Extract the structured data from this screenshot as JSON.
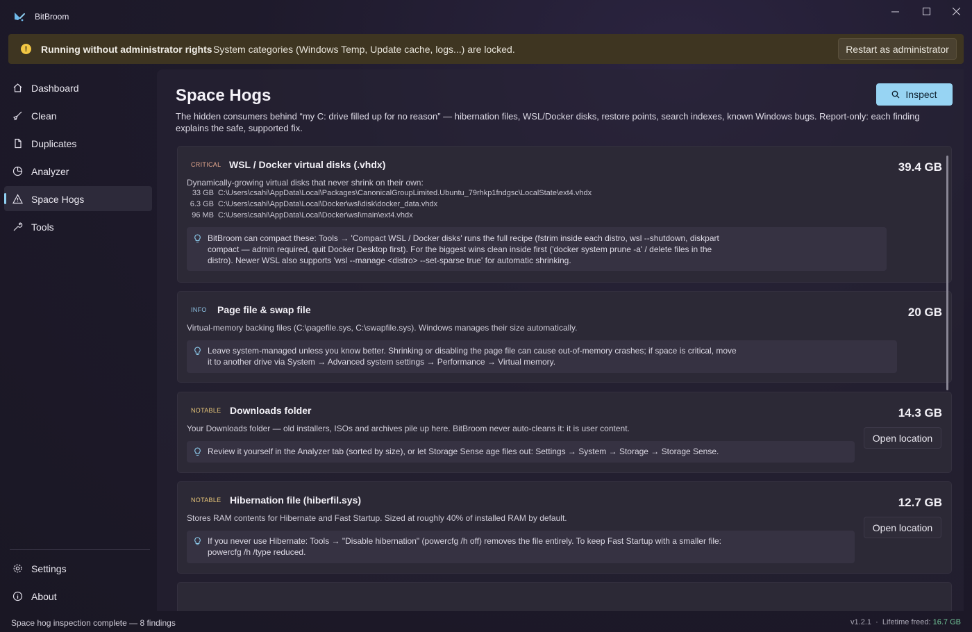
{
  "window": {
    "title": "BitBroom"
  },
  "banner": {
    "title": "Running without administrator rights",
    "message": "System categories (Windows Temp, Update cache, logs...) are locked.",
    "button": "Restart as administrator"
  },
  "sidebar": {
    "items": [
      {
        "label": "Dashboard",
        "icon": "home-icon"
      },
      {
        "label": "Clean",
        "icon": "broom-icon"
      },
      {
        "label": "Duplicates",
        "icon": "copy-icon"
      },
      {
        "label": "Analyzer",
        "icon": "pie-chart-icon"
      },
      {
        "label": "Space Hogs",
        "icon": "warning-icon",
        "active": true
      },
      {
        "label": "Tools",
        "icon": "wrench-icon"
      }
    ],
    "footer": [
      {
        "label": "Settings",
        "icon": "gear-icon"
      },
      {
        "label": "About",
        "icon": "info-icon"
      }
    ]
  },
  "page": {
    "title": "Space Hogs",
    "description": "The hidden consumers behind “my C: drive filled up for no reason” — hibernation files, WSL/Docker disks, restore points, search indexes, known Windows bugs. Report-only: each finding explains the safe, supported fix.",
    "inspect_button": "Inspect"
  },
  "findings": [
    {
      "severity": "CRITICAL",
      "title": "WSL / Docker virtual disks (.vhdx)",
      "size": "39.4 GB",
      "description": "Dynamically-growing virtual disks that never shrink on their own:",
      "paths": [
        {
          "size": "33 GB",
          "path": "C:\\Users\\csahi\\AppData\\Local\\Packages\\CanonicalGroupLimited.Ubuntu_79rhkp1fndgsc\\LocalState\\ext4.vhdx"
        },
        {
          "size": "6.3 GB",
          "path": "C:\\Users\\csahi\\AppData\\Local\\Docker\\wsl\\disk\\docker_data.vhdx"
        },
        {
          "size": "96 MB",
          "path": "C:\\Users\\csahi\\AppData\\Local\\Docker\\wsl\\main\\ext4.vhdx"
        }
      ],
      "tip_lines": [
        "BitBroom can compact these: Tools → 'Compact WSL / Docker disks' runs the full recipe (fstrim inside each distro, wsl --shutdown, diskpart",
        "compact — admin required, quit Docker Desktop first). For the biggest wins clean inside first ('docker system prune -a' / delete files in the",
        "distro). Newer WSL also supports 'wsl --manage <distro> --set-sparse true' for automatic shrinking."
      ]
    },
    {
      "severity": "INFO",
      "title": "Page file & swap file",
      "size": "20 GB",
      "description": "Virtual-memory backing files (C:\\pagefile.sys, C:\\swapfile.sys). Windows manages their size automatically.",
      "tip_lines": [
        "Leave system-managed unless you know better. Shrinking or disabling the page file can cause out-of-memory crashes; if space is critical, move",
        "it to another drive via System → Advanced system settings → Performance → Virtual memory."
      ]
    },
    {
      "severity": "NOTABLE",
      "title": "Downloads folder",
      "size": "14.3 GB",
      "description": "Your Downloads folder — old installers, ISOs and archives pile up here. BitBroom never auto-cleans it: it is user content.",
      "tip_lines": [
        "Review it yourself in the Analyzer tab (sorted by size), or let Storage Sense age files out: Settings → System → Storage → Storage Sense."
      ],
      "action": "Open location"
    },
    {
      "severity": "NOTABLE",
      "title": "Hibernation file (hiberfil.sys)",
      "size": "12.7 GB",
      "description": "Stores RAM contents for Hibernate and Fast Startup. Sized at roughly 40% of installed RAM by default.",
      "tip_lines": [
        "If you never use Hibernate: Tools → \"Disable hibernation\" (powercfg /h off) removes the file entirely. To keep Fast Startup with a smaller file:",
        "powercfg /h /type reduced."
      ],
      "action": "Open location"
    }
  ],
  "status": {
    "message": "Space hog inspection complete — 8 findings",
    "version": "v1.2.1",
    "lifetime_label": "Lifetime freed:",
    "lifetime_value": "16.7 GB"
  },
  "colors": {
    "accent": "#97d4f3",
    "warning": "#f2c744",
    "freed": "#74c89b"
  }
}
